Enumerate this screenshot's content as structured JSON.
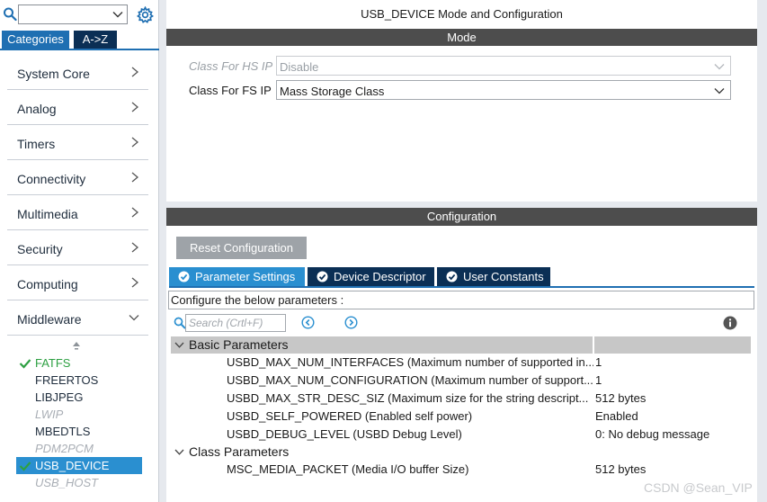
{
  "sidebar": {
    "search": {
      "value": ""
    },
    "tabs": [
      {
        "label": "Categories",
        "active": true
      },
      {
        "label": "A->Z",
        "active": false
      }
    ],
    "categories": [
      {
        "label": "System Core",
        "icon": "chevron-right-icon"
      },
      {
        "label": "Analog",
        "icon": "chevron-right-icon"
      },
      {
        "label": "Timers",
        "icon": "chevron-right-icon"
      },
      {
        "label": "Connectivity",
        "icon": "chevron-right-icon"
      },
      {
        "label": "Multimedia",
        "icon": "chevron-right-icon"
      },
      {
        "label": "Security",
        "icon": "chevron-right-icon"
      },
      {
        "label": "Computing",
        "icon": "chevron-right-icon"
      },
      {
        "label": "Middleware",
        "icon": "chevron-down-icon"
      }
    ],
    "middleware": [
      {
        "label": "FATFS",
        "state": "checked"
      },
      {
        "label": "FREERTOS",
        "state": "normal"
      },
      {
        "label": "LIBJPEG",
        "state": "normal"
      },
      {
        "label": "LWIP",
        "state": "disabled"
      },
      {
        "label": "MBEDTLS",
        "state": "normal"
      },
      {
        "label": "PDM2PCM",
        "state": "disabled"
      },
      {
        "label": "USB_DEVICE",
        "state": "selected"
      },
      {
        "label": "USB_HOST",
        "state": "disabled"
      }
    ]
  },
  "mode": {
    "title": "USB_DEVICE Mode and Configuration",
    "header": "Mode",
    "hs": {
      "label": "Class For HS IP",
      "value": "Disable"
    },
    "fs": {
      "label": "Class For FS IP",
      "value": "Mass Storage Class"
    }
  },
  "config": {
    "header": "Configuration",
    "reset_label": "Reset Configuration",
    "tabs": [
      {
        "label": "Parameter Settings",
        "active": true
      },
      {
        "label": "Device Descriptor",
        "active": false
      },
      {
        "label": "User Constants",
        "active": false
      }
    ],
    "info_text": "Configure the below parameters :",
    "search_placeholder": "Search (Crtl+F)",
    "groups": [
      {
        "label": "Basic Parameters",
        "params": [
          {
            "name": "USBD_MAX_NUM_INTERFACES (Maximum number of supported in...",
            "value": "1"
          },
          {
            "name": "USBD_MAX_NUM_CONFIGURATION (Maximum number of support...",
            "value": "1"
          },
          {
            "name": "USBD_MAX_STR_DESC_SIZ (Maximum size for the string descript...",
            "value": "512 bytes"
          },
          {
            "name": "USBD_SELF_POWERED (Enabled self power)",
            "value": "Enabled"
          },
          {
            "name": "USBD_DEBUG_LEVEL (USBD Debug Level)",
            "value": "0: No debug message"
          }
        ]
      },
      {
        "label": "Class Parameters",
        "params": [
          {
            "name": "MSC_MEDIA_PACKET (Media I/O buffer Size)",
            "value": "512 bytes"
          }
        ]
      }
    ]
  },
  "watermark": "CSDN @Sean_VIP",
  "colors": {
    "accent_blue": "#2a8fd0",
    "dark_navy": "#0b2f55",
    "header_gray": "#4d4d4d",
    "check_green": "#2ea043"
  }
}
